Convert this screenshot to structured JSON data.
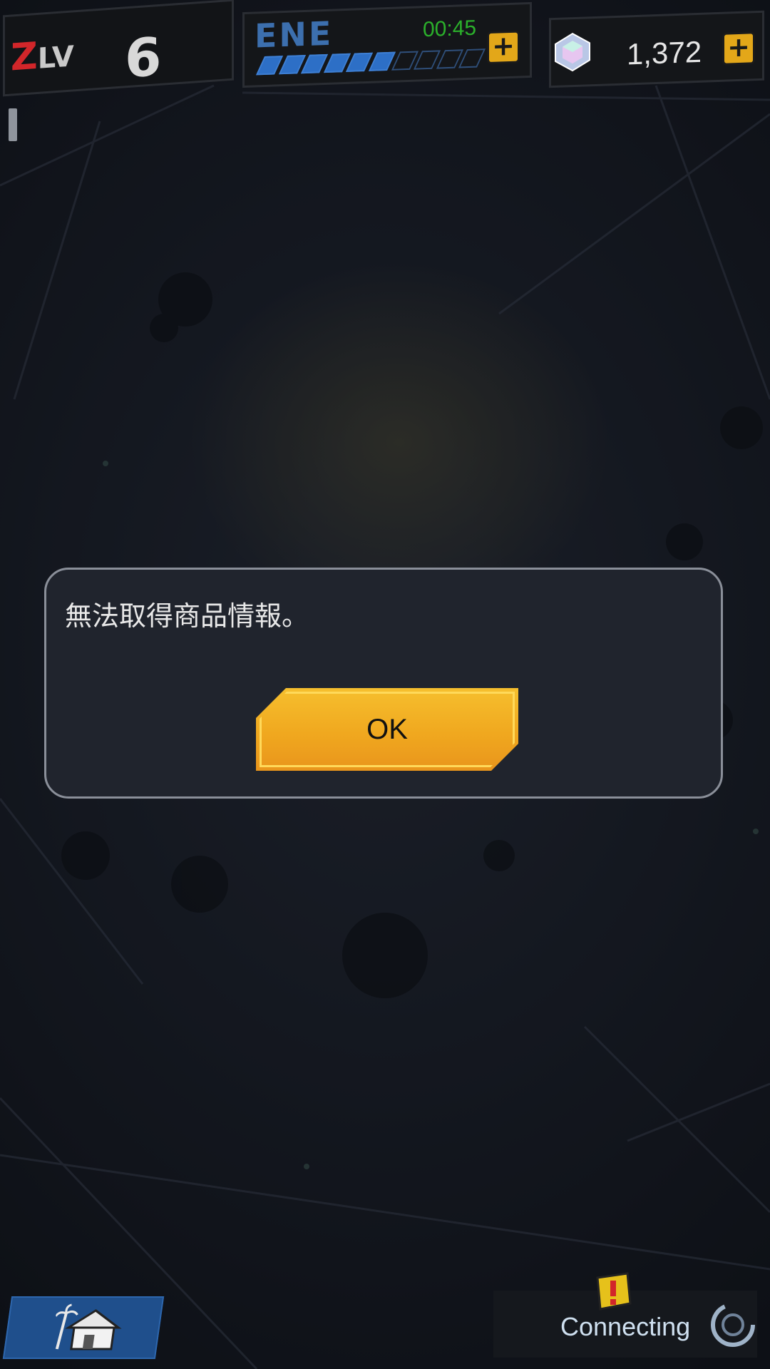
{
  "hud": {
    "level_label": "LV",
    "level_z": "Z",
    "level_value": "6",
    "energy_label": "ENE",
    "energy_timer": "00:45",
    "energy_fraction": 0.6,
    "energy_add_icon": "plus-icon",
    "gems_icon": "gem-icon",
    "gems_count": "1,372",
    "gems_add_icon": "plus-icon"
  },
  "dialog": {
    "message": "無法取得商品情報。",
    "ok_label": "OK"
  },
  "bottom": {
    "home_icon": "home-icon",
    "status_text": "Connecting",
    "alert_icon": "alert-icon",
    "spinner_icon": "spinner-icon"
  },
  "colors": {
    "accent_gold": "#f0a81f",
    "energy_blue": "#2d6fc6",
    "timer_green": "#2bb02b",
    "level_red": "#d2262a"
  }
}
